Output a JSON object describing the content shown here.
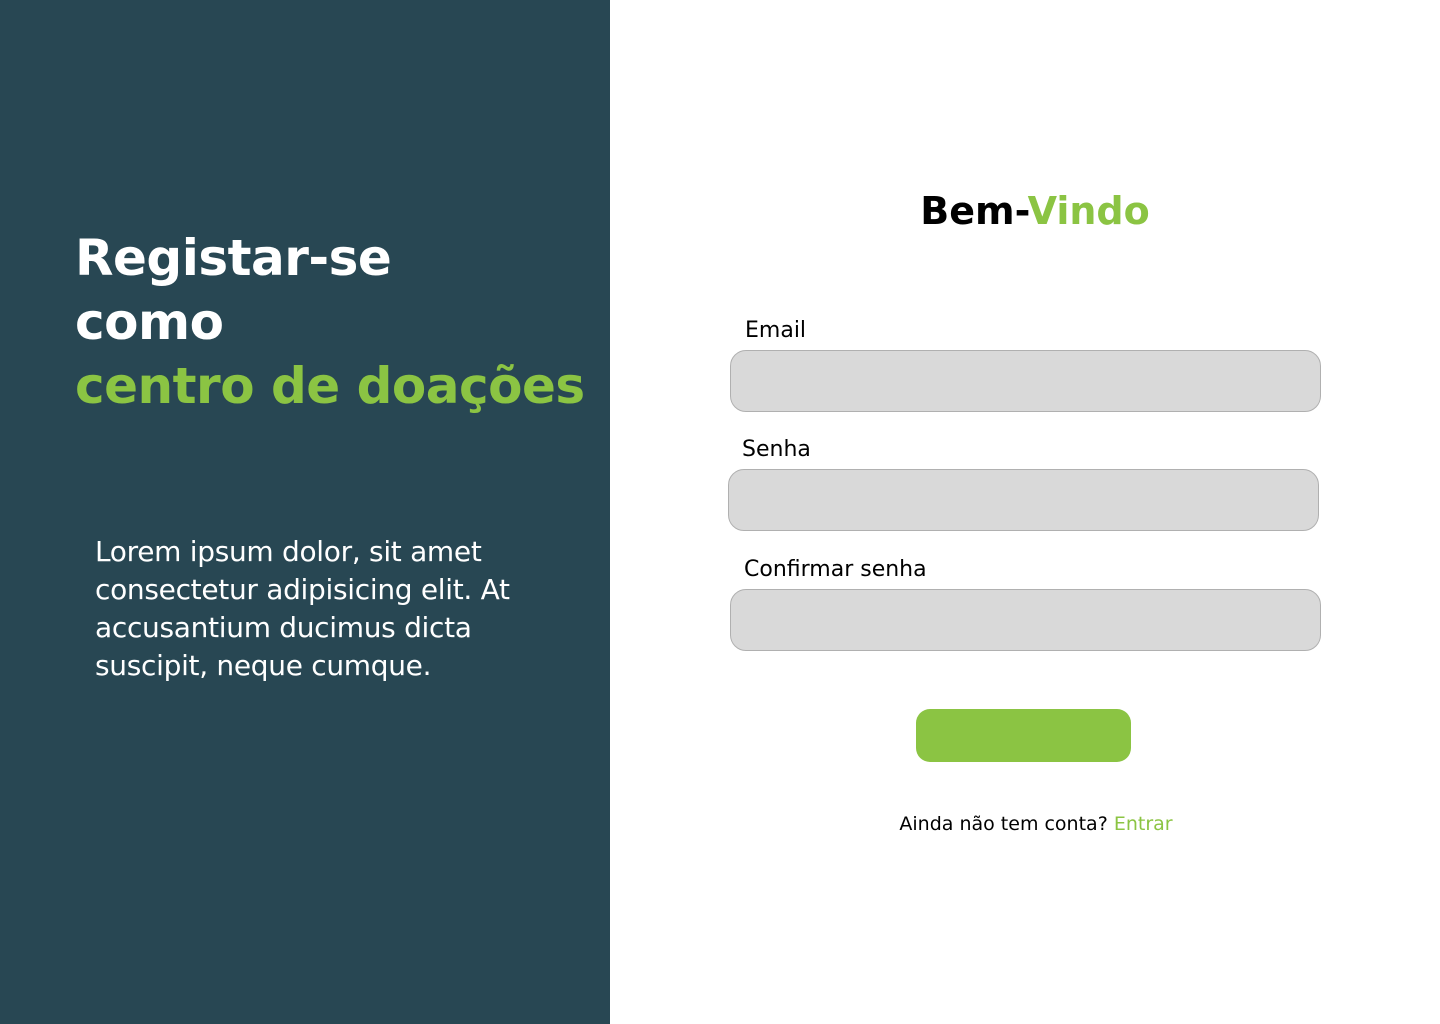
{
  "hero": {
    "title_line1": "Registar-se",
    "title_line2": "como",
    "title_line3": "centro de doações",
    "description": "Lorem ipsum dolor, sit amet consectetur adipisicing elit. At accusantium ducimus dicta suscipit, neque cumque."
  },
  "form": {
    "welcome_part1": "Bem-",
    "welcome_part2": "Vindo",
    "email_label": "Email",
    "email_value": "",
    "password_label": "Senha",
    "password_value": "",
    "confirm_label": "Confirmar senha",
    "confirm_value": "",
    "submit_label": ""
  },
  "signup": {
    "prompt": "Ainda não tem conta? ",
    "link_label": "Entrar"
  },
  "colors": {
    "sidebar_bg": "#284753",
    "accent": "#8bc443",
    "input_bg": "#d9d9d9"
  }
}
